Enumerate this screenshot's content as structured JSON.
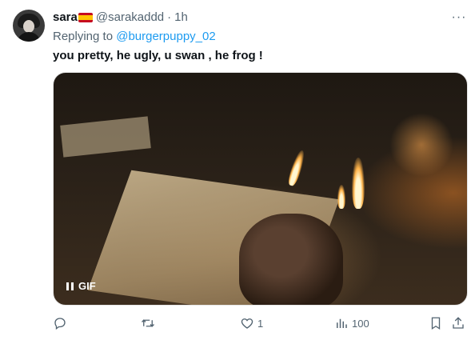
{
  "tweet": {
    "display_name": "sara",
    "flag_icon": "spain-flag-icon",
    "handle": "@sarakaddd",
    "separator": "·",
    "time": "1h",
    "more_icon": "more-horizontal-icon",
    "more_glyph": "···",
    "replying_prefix": "Replying to",
    "replying_to": "@burgerpuppy_02",
    "text": "you pretty, he ugly, u swan , he frog !"
  },
  "media": {
    "badge_label": "GIF",
    "pause_icon": "pause-icon"
  },
  "actions": {
    "reply": {
      "icon": "reply-icon",
      "count": ""
    },
    "retweet": {
      "icon": "retweet-icon",
      "count": ""
    },
    "like": {
      "icon": "heart-icon",
      "count": "1"
    },
    "views": {
      "icon": "views-icon",
      "count": "100"
    },
    "bookmark": {
      "icon": "bookmark-icon"
    },
    "share": {
      "icon": "share-icon"
    }
  },
  "colors": {
    "link": "#1d9bf0",
    "secondary_text": "#536471",
    "primary_text": "#0f1419"
  }
}
